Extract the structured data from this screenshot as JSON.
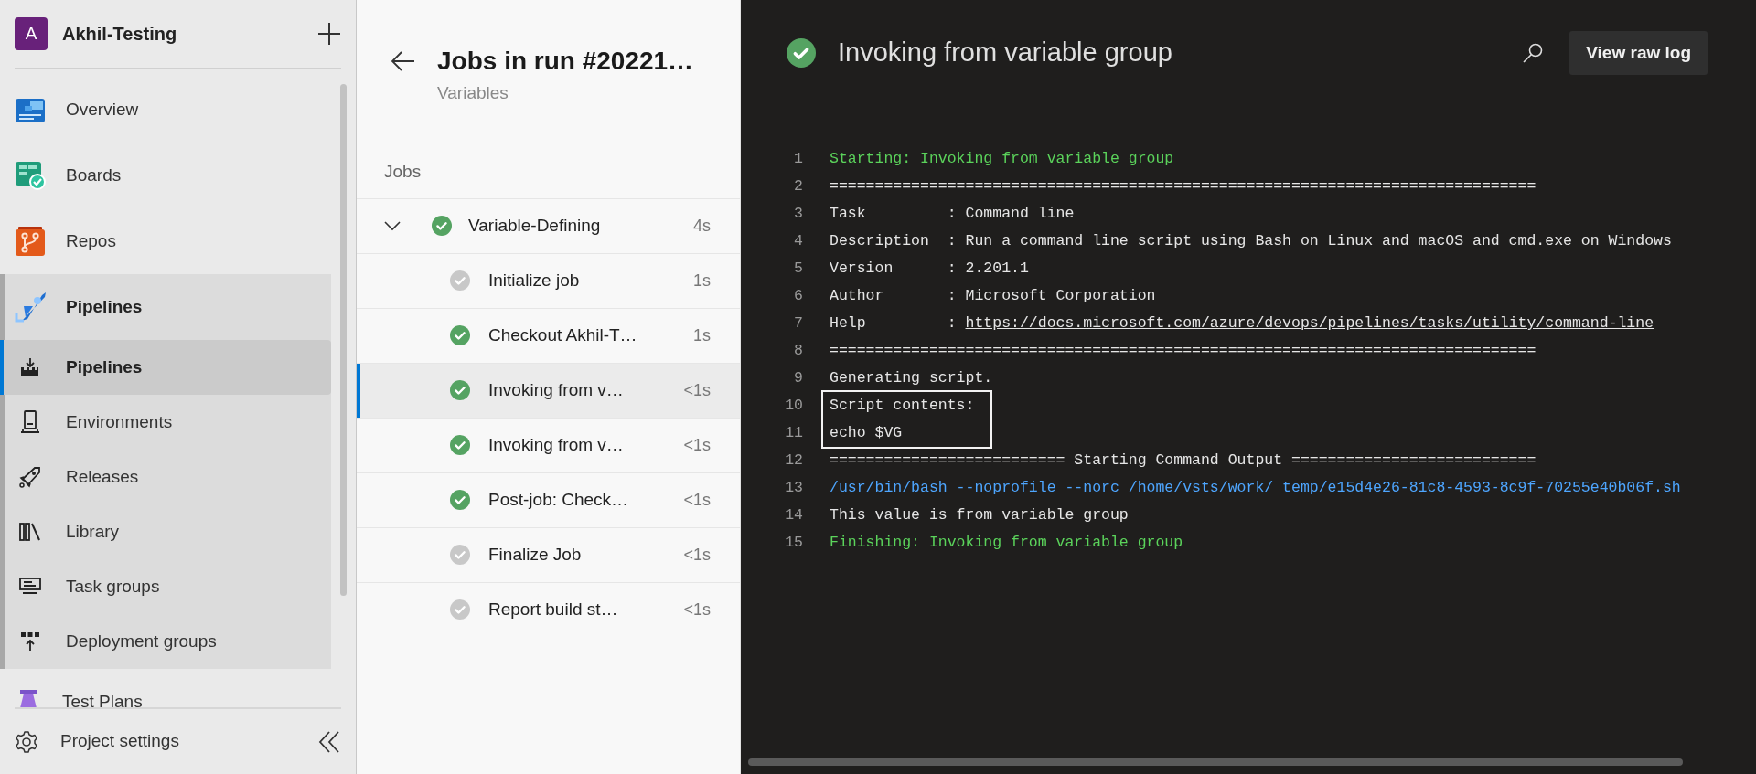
{
  "sidebar": {
    "org": {
      "initial": "A",
      "name": "Akhil-Testing"
    },
    "nav": [
      {
        "label": "Overview",
        "selected": false
      },
      {
        "label": "Boards",
        "selected": false
      },
      {
        "label": "Repos",
        "selected": false
      },
      {
        "label": "Pipelines",
        "selected": true,
        "expanded": true,
        "children": [
          {
            "label": "Pipelines",
            "selected": true
          },
          {
            "label": "Environments",
            "selected": false
          },
          {
            "label": "Releases",
            "selected": false
          },
          {
            "label": "Library",
            "selected": false
          },
          {
            "label": "Task groups",
            "selected": false
          },
          {
            "label": "Deployment groups",
            "selected": false
          }
        ]
      },
      {
        "label": "Test Plans",
        "selected": false
      }
    ],
    "footer": {
      "label": "Project settings"
    }
  },
  "jobs_panel": {
    "title": "Jobs in run #20221…",
    "subtitle": "Variables",
    "section": "Jobs",
    "groups": [
      {
        "name": "Variable-Defining",
        "duration": "4s",
        "succeeded": true,
        "expanded": true,
        "steps": [
          {
            "name": "Initialize job",
            "duration": "1s",
            "succeeded": false,
            "selected": false
          },
          {
            "name": "Checkout Akhil-T…",
            "duration": "1s",
            "succeeded": true,
            "selected": false
          },
          {
            "name": "Invoking from v…",
            "duration": "<1s",
            "succeeded": true,
            "selected": true
          },
          {
            "name": "Invoking from v…",
            "duration": "<1s",
            "succeeded": true,
            "selected": false
          },
          {
            "name": "Post-job: Check…",
            "duration": "<1s",
            "succeeded": true,
            "selected": false
          },
          {
            "name": "Finalize Job",
            "duration": "<1s",
            "succeeded": false,
            "selected": false
          },
          {
            "name": "Report build st…",
            "duration": "<1s",
            "succeeded": false,
            "selected": false
          }
        ]
      }
    ]
  },
  "log": {
    "title": "Invoking from variable group",
    "succeeded": true,
    "button": "View raw log",
    "lines": [
      {
        "number": "1",
        "kind": "section",
        "text": "Starting: Invoking from variable group",
        "highlighted": false
      },
      {
        "number": "2",
        "kind": "plain",
        "text": "==============================================================================",
        "highlighted": false
      },
      {
        "number": "3",
        "kind": "plain",
        "text": "Task         : Command line",
        "highlighted": false
      },
      {
        "number": "4",
        "kind": "plain",
        "text": "Description  : Run a command line script using Bash on Linux and macOS and cmd.exe on Windows",
        "highlighted": false
      },
      {
        "number": "5",
        "kind": "plain",
        "text": "Version      : 2.201.1",
        "highlighted": false
      },
      {
        "number": "6",
        "kind": "plain",
        "text": "Author       : Microsoft Corporation",
        "highlighted": false
      },
      {
        "number": "7",
        "kind": "link",
        "text": "Help         : ",
        "link": "https://docs.microsoft.com/azure/devops/pipelines/tasks/utility/command-line",
        "highlighted": false
      },
      {
        "number": "8",
        "kind": "plain",
        "text": "==============================================================================",
        "highlighted": false
      },
      {
        "number": "9",
        "kind": "plain",
        "text": "Generating script.",
        "highlighted": false
      },
      {
        "number": "10",
        "kind": "plain",
        "text": "Script contents:",
        "highlighted": true
      },
      {
        "number": "11",
        "kind": "plain",
        "text": "echo $VG",
        "highlighted": true
      },
      {
        "number": "12",
        "kind": "plain",
        "text": "========================== Starting Command Output ===========================",
        "highlighted": false
      },
      {
        "number": "13",
        "kind": "command",
        "text": "/usr/bin/bash --noprofile --norc /home/vsts/work/_temp/e15d4e26-81c8-4593-8c9f-70255e40b06f.sh",
        "highlighted": false
      },
      {
        "number": "14",
        "kind": "plain",
        "text": "This value is from variable group",
        "highlighted": false
      },
      {
        "number": "15",
        "kind": "section",
        "text": "Finishing: Invoking from variable group",
        "highlighted": false
      }
    ]
  }
}
